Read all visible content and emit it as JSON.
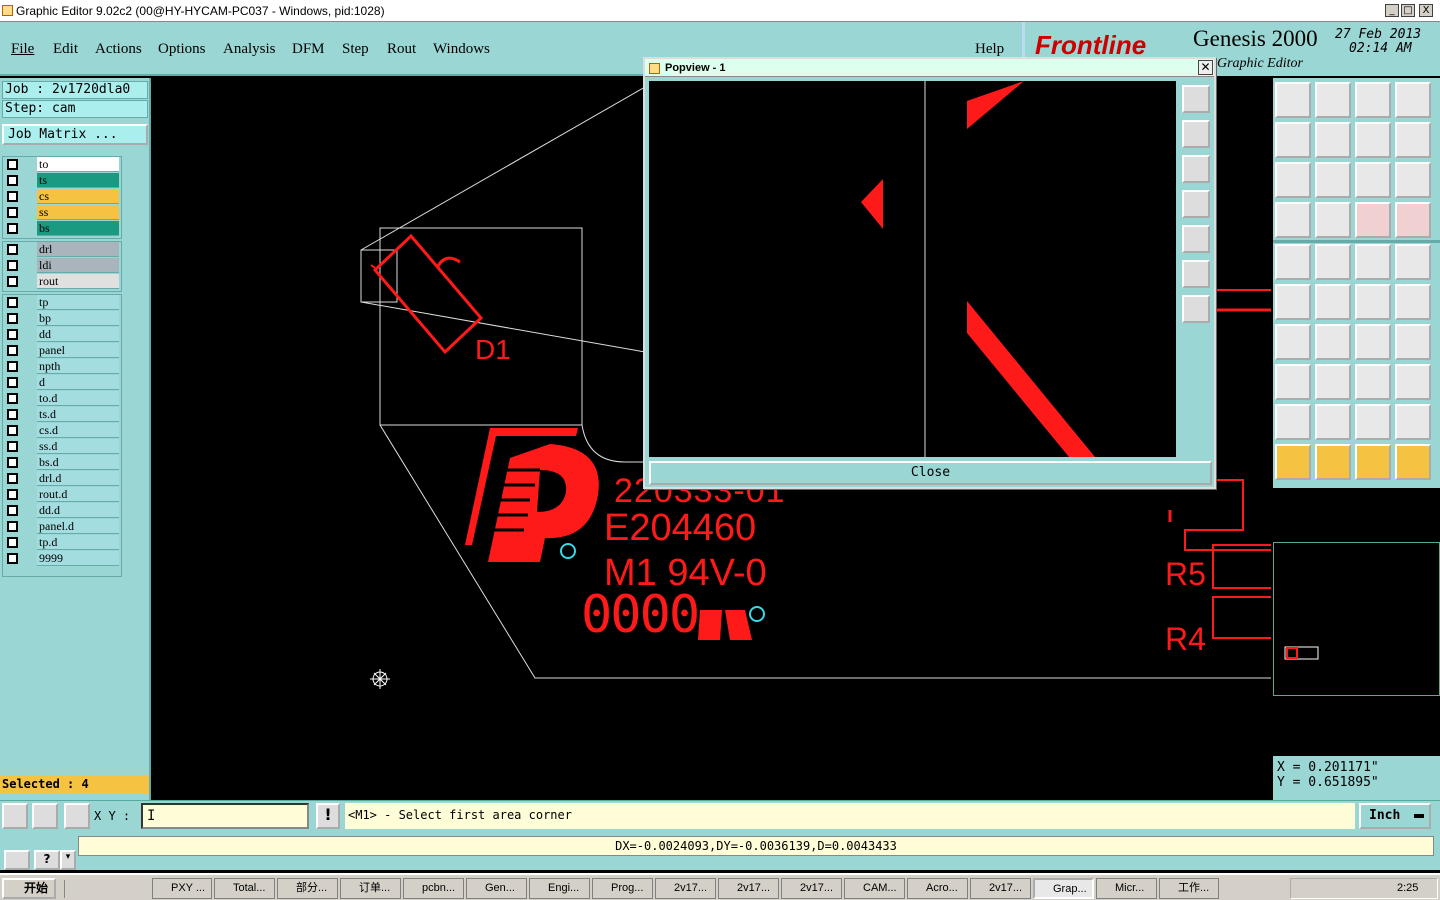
{
  "window": {
    "title": "Graphic Editor 9.02c2 (00@HY-HYCAM-PC037 - Windows, pid:1028)",
    "buttons": [
      "_",
      "□",
      "X"
    ]
  },
  "menu": [
    "File",
    "Edit",
    "Actions",
    "Options",
    "Analysis",
    "DFM",
    "Step",
    "Rout",
    "Windows"
  ],
  "help_label": "Help",
  "brand": {
    "logo": "Frontline",
    "product": "Genesis 2000",
    "subtitle": "Graphic Editor",
    "date": "27 Feb 2013",
    "time": "02:14 AM"
  },
  "job": {
    "job_line": "Job : 2v1720dla0",
    "step_line": "Step: cam",
    "matrix_button": "Job Matrix ..."
  },
  "layers_group1": [
    {
      "name": "to",
      "color": "#ffffff"
    },
    {
      "name": "ts",
      "color": "#1a9a80"
    },
    {
      "name": "cs",
      "color": "#f5c242"
    },
    {
      "name": "ss",
      "color": "#f5c242"
    },
    {
      "name": "bs",
      "color": "#1a9a80"
    }
  ],
  "layers_group2": [
    {
      "name": "drl",
      "color": "#a9b4bc"
    },
    {
      "name": "ldi",
      "color": "#a9b4bc"
    },
    {
      "name": "rout",
      "color": "#e0e0e0"
    }
  ],
  "layers_group3": [
    {
      "name": "tp",
      "color": "#a3dde0"
    },
    {
      "name": "bp",
      "color": "#a3dde0"
    },
    {
      "name": "dd",
      "color": "#a3dde0"
    },
    {
      "name": "panel",
      "color": "#a3dde0"
    },
    {
      "name": "npth",
      "color": "#a3dde0"
    },
    {
      "name": "d",
      "color": "#a3dde0"
    },
    {
      "name": "to.d",
      "color": "#a3dde0"
    },
    {
      "name": "ts.d",
      "color": "#a3dde0"
    },
    {
      "name": "cs.d",
      "color": "#a3dde0"
    },
    {
      "name": "ss.d",
      "color": "#a3dde0"
    },
    {
      "name": "bs.d",
      "color": "#a3dde0"
    },
    {
      "name": "drl.d",
      "color": "#a3dde0"
    },
    {
      "name": "rout.d",
      "color": "#a3dde0"
    },
    {
      "name": "dd.d",
      "color": "#a3dde0"
    },
    {
      "name": "panel.d",
      "color": "#a3dde0"
    },
    {
      "name": "tp.d",
      "color": "#a3dde0"
    },
    {
      "name": "9999",
      "color": "#a3dde0"
    }
  ],
  "selected": "Selected : 4",
  "canvas_text": {
    "d1": "D1",
    "part": "220333-01",
    "ul": "E204460",
    "rating": "M1 94V-0",
    "code": "0000",
    "r5": "R5",
    "r4": "R4"
  },
  "popview": {
    "title": "Popview - 1",
    "close": "Close"
  },
  "coords": {
    "x": "X = 0.201171\"",
    "y": "Y = 0.651895\""
  },
  "command": {
    "xy_label": "X Y :",
    "xy_value": "I",
    "prompt": "<M1> - Select first area corner",
    "unit": "Inch"
  },
  "status_text": "DX=-0.0024093,DY=-0.0036139,D=0.0043433",
  "taskbar": {
    "start": "开始",
    "clock": "2:25",
    "tasks": [
      "PXY ...",
      "Total...",
      "部分...",
      "订单...",
      "pcbn...",
      "Gen...",
      "Engi...",
      "Prog...",
      "2v17...",
      "2v17...",
      "2v17...",
      "CAM...",
      "Acro...",
      "2v17...",
      "Grap...",
      "Micr...",
      "工作..."
    ]
  },
  "colors": {
    "teal": "#9ad6d4",
    "red": "#ff1a1a",
    "cyan": "#3ad7e6"
  }
}
